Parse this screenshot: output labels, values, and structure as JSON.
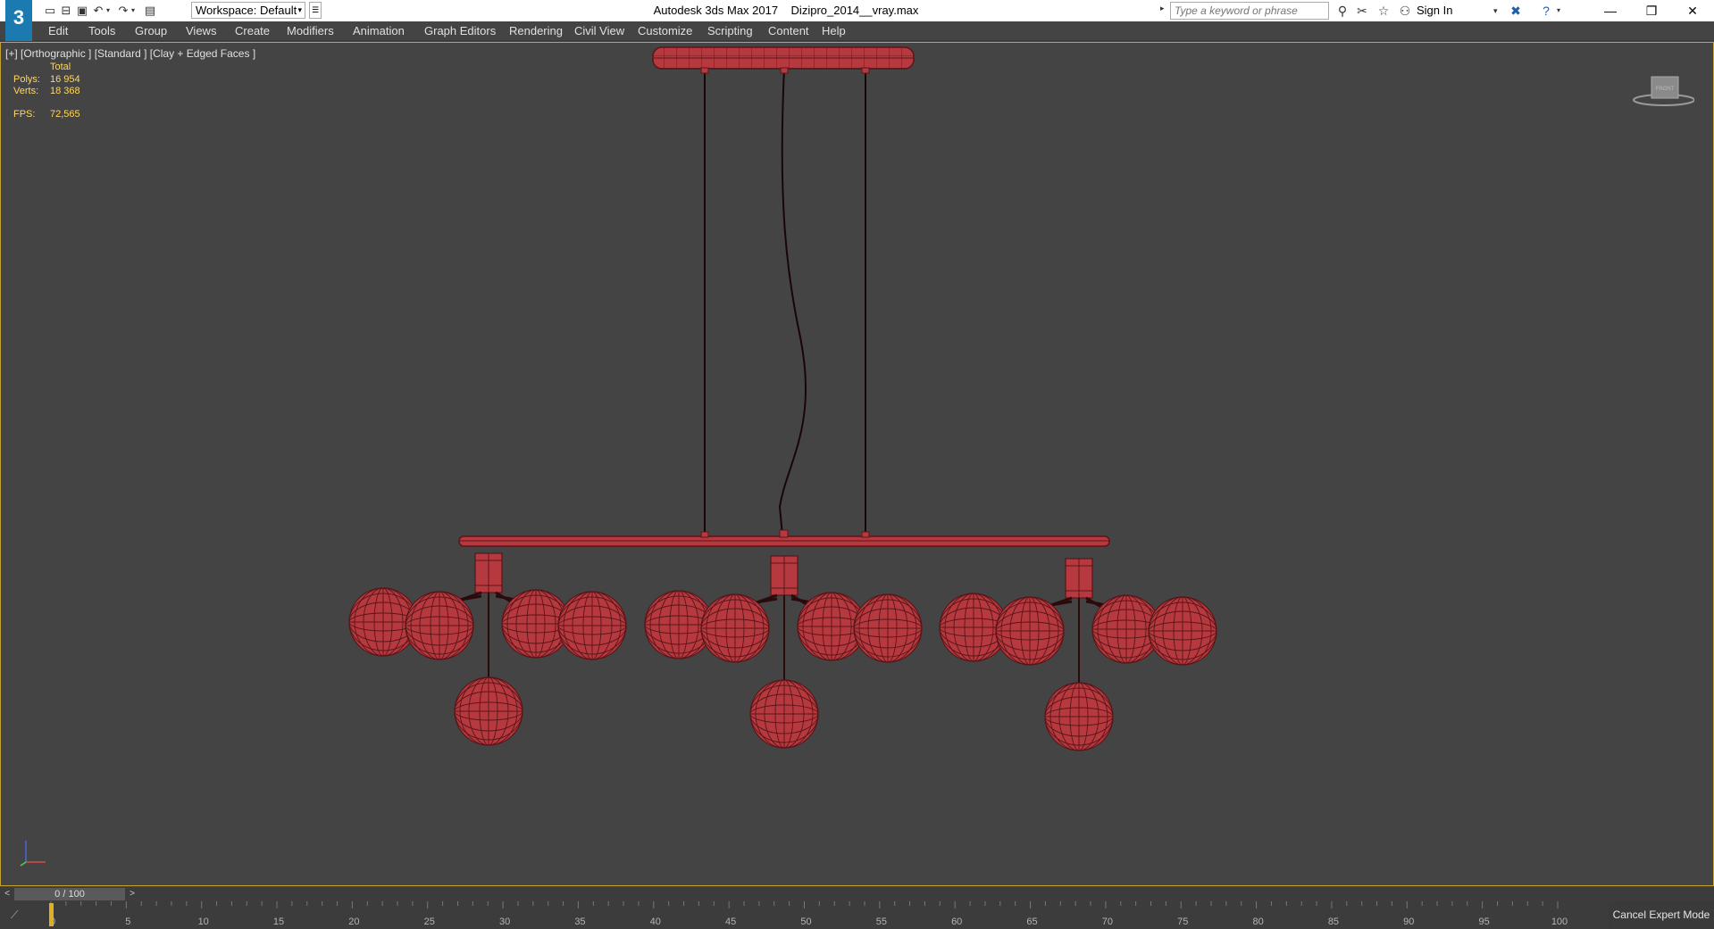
{
  "titlebar": {
    "app_name": "Autodesk 3ds Max 2017",
    "file_name": "Dizipro_2014__vray.max",
    "workspace_label": "Workspace: Default",
    "search_placeholder": "Type a keyword or phrase",
    "sign_in_label": "Sign In"
  },
  "menu": [
    "Edit",
    "Tools",
    "Group",
    "Views",
    "Create",
    "Modifiers",
    "Animation",
    "Graph Editors",
    "Rendering",
    "Civil View",
    "Customize",
    "Scripting",
    "Content",
    "Help"
  ],
  "viewport": {
    "label": "[+] [Orthographic ] [Standard ] [Clay + Edged Faces ]",
    "stats": {
      "total_label": "Total",
      "polys_label": "Polys:",
      "polys_value": "16 954",
      "verts_label": "Verts:",
      "verts_value": "18 368",
      "fps_label": "FPS:",
      "fps_value": "72,565"
    },
    "viewcube_label": "FRONT"
  },
  "timeline": {
    "slider_text": "0 / 100",
    "current_frame": 0,
    "frame_range": [
      0,
      100
    ],
    "ticks": [
      "0",
      "5",
      "10",
      "15",
      "20",
      "25",
      "30",
      "35",
      "40",
      "45",
      "50",
      "55",
      "60",
      "65",
      "70",
      "75",
      "80",
      "85",
      "90",
      "95",
      "100"
    ]
  },
  "status": {
    "cancel_expert_label": "Cancel Expert Mode"
  },
  "colors": {
    "model_fill": "#b5393f",
    "model_wire": "#5a1518",
    "viewport_bg": "#444444",
    "viewport_border": "#c8a030",
    "stats_text": "#ffd860"
  }
}
